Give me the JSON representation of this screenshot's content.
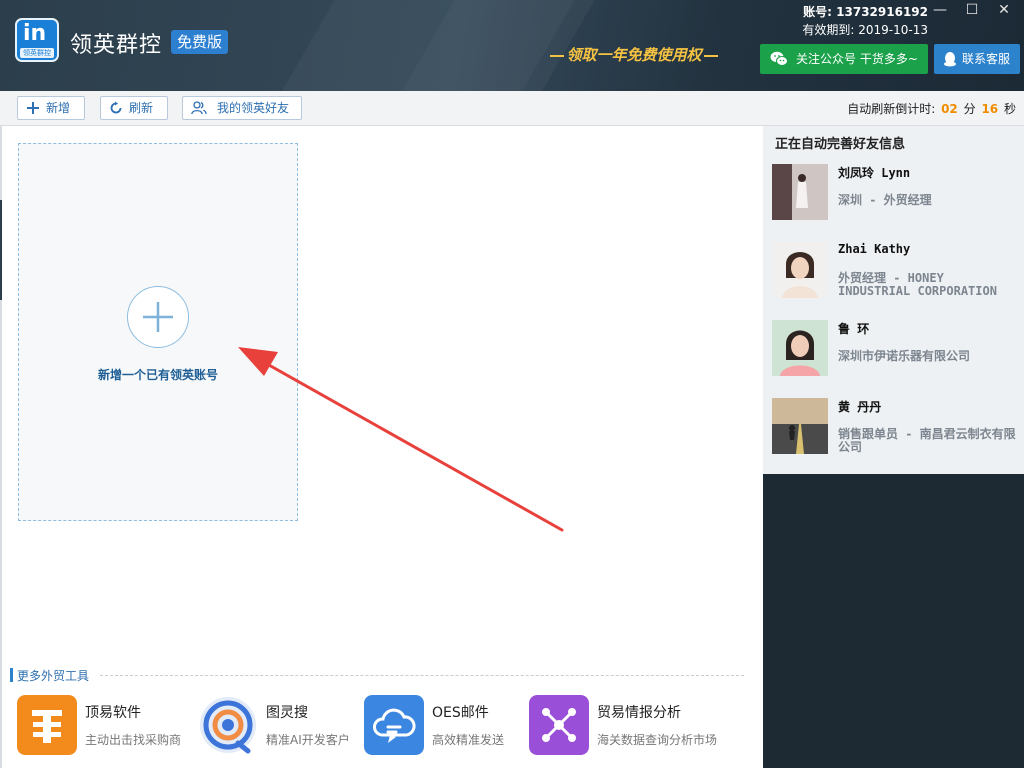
{
  "header": {
    "logo_text": "in",
    "logo_tag": "领英群控",
    "app_title": "领英群控",
    "edition_badge": "免费版",
    "promo_text": "领取一年免费使用权",
    "account_label": "账号: 13732916192",
    "expire_label": "有效期到: 2019-10-13",
    "wechat_button": "关注公众号 干货多多~",
    "service_button": "联系客服",
    "window_controls": {
      "minimize": "—",
      "maximize": "☐",
      "close": "✕"
    }
  },
  "toolbar": {
    "add_label": "新增",
    "refresh_label": "刷新",
    "friends_label": "我的领英好友",
    "timer_prefix": "自动刷新倒计时:",
    "timer_minutes": "02",
    "timer_min_unit": "分",
    "timer_seconds": "16",
    "timer_sec_unit": "秒"
  },
  "main": {
    "add_account_text": "新增一个已有领英账号"
  },
  "tools": {
    "title": "更多外贸工具",
    "items": [
      {
        "name": "顶易软件",
        "desc": "主动出击找采购商",
        "color": "#f28a1c"
      },
      {
        "name": "图灵搜",
        "desc": "精准AI开发客户",
        "color": "#3d74d9"
      },
      {
        "name": "OES邮件",
        "desc": "高效精准发送",
        "color": "#3a86e0"
      },
      {
        "name": "贸易情报分析",
        "desc": "海关数据查询分析市场",
        "color": "#9a4fd8"
      }
    ]
  },
  "right_panel": {
    "title": "正在自动完善好友信息",
    "friends": [
      {
        "name": "刘凤玲 Lynn",
        "desc": "深圳 - 外贸经理"
      },
      {
        "name": "Zhai Kathy",
        "desc": "外贸经理 - HONEY INDUSTRIAL CORPORATION"
      },
      {
        "name": "鲁 环",
        "desc": "深圳市伊诺乐器有限公司"
      },
      {
        "name": "黄 丹丹",
        "desc": "销售跟单员 - 南昌君云制衣有限公司"
      }
    ]
  },
  "colors": {
    "header_bg": "#2c3e4b",
    "accent_blue": "#2d82cc",
    "wechat_green": "#1aa14a",
    "promo_gold": "#f5c242",
    "timer_orange": "#f08c00",
    "arrow_red": "#e8413c"
  }
}
